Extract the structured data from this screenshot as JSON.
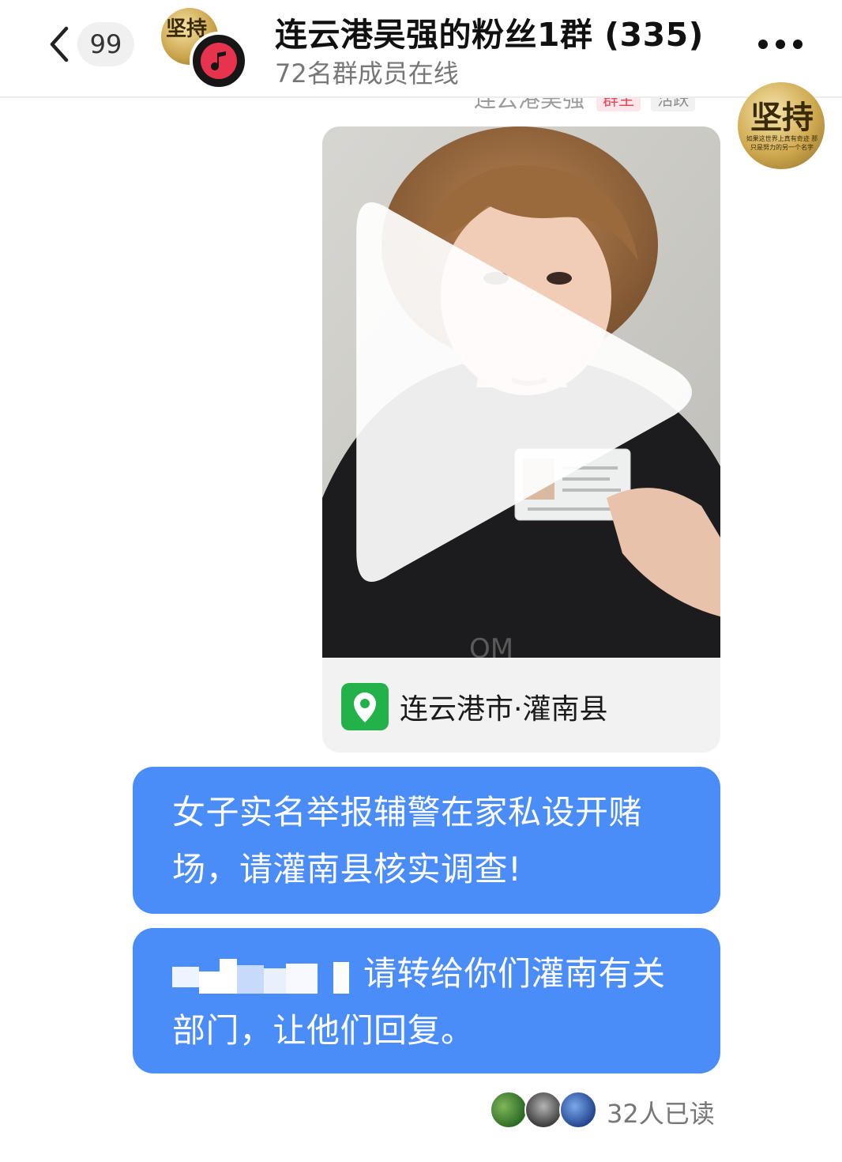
{
  "header": {
    "back_icon": "chevron-left-icon",
    "unread_count": "99",
    "title": "连云港吴强的粉丝1群 (335)",
    "subtitle": "72名群成员在线",
    "more_icon": "more-dots-icon",
    "avatar_small_text": "坚持"
  },
  "message": {
    "sender_name": "连云港吴强",
    "sender_role": "群主",
    "sender_badge": "活跃",
    "sender_avatar_text": "坚持",
    "sender_avatar_subtext": "如果这世界上真有奇迹 那只是努力的另一个名字",
    "video": {
      "play_icon": "play-icon",
      "location_icon": "location-pin-icon",
      "location": "连云港市·灌南县"
    },
    "text_1": "女子实名举报辅警在家私设开赌场，请灌南县核实调查!",
    "text_2": "请转给你们灌南有关部门，让他们回复。"
  },
  "read_receipt": {
    "text": "32人已读"
  },
  "colors": {
    "bubble": "#4b8df8",
    "location_icon_bg": "#23b24a",
    "role_badge": "#e2485c"
  }
}
